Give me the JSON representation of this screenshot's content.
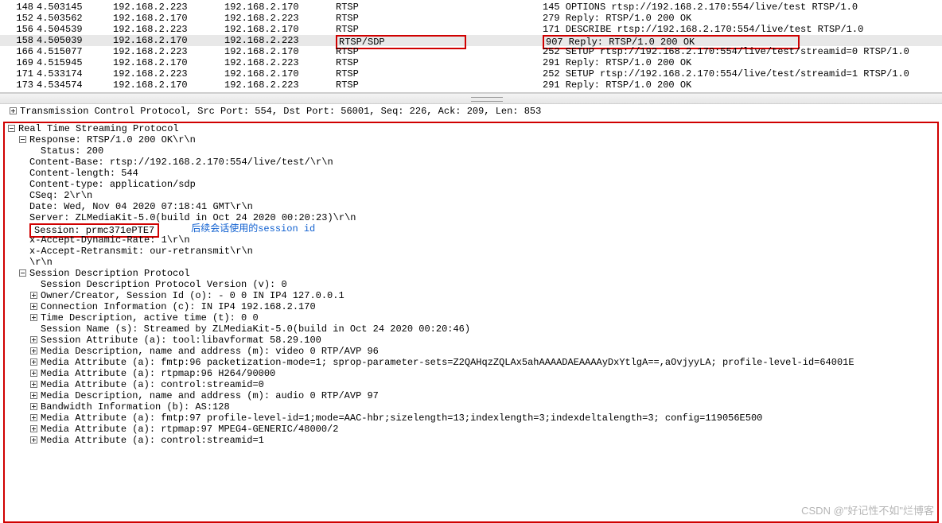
{
  "packets": [
    {
      "no": "148",
      "time": "4.503145",
      "src": "192.168.2.223",
      "dst": "192.168.2.170",
      "proto": "RTSP",
      "info": "145 OPTIONS rtsp://192.168.2.170:554/live/test RTSP/1.0",
      "sel": false,
      "hl": false
    },
    {
      "no": "152",
      "time": "4.503562",
      "src": "192.168.2.170",
      "dst": "192.168.2.223",
      "proto": "RTSP",
      "info": "279 Reply: RTSP/1.0 200 OK",
      "sel": false,
      "hl": false
    },
    {
      "no": "156",
      "time": "4.504539",
      "src": "192.168.2.223",
      "dst": "192.168.2.170",
      "proto": "RTSP",
      "info": "171 DESCRIBE rtsp://192.168.2.170:554/live/test RTSP/1.0",
      "sel": false,
      "hl": false
    },
    {
      "no": "158",
      "time": "4.505039",
      "src": "192.168.2.170",
      "dst": "192.168.2.223",
      "proto": "RTSP/SDP",
      "info": "907 Reply: RTSP/1.0 200 OK",
      "sel": true,
      "hl": true
    },
    {
      "no": "166",
      "time": "4.515077",
      "src": "192.168.2.223",
      "dst": "192.168.2.170",
      "proto": "RTSP",
      "info": "252 SETUP rtsp://192.168.2.170:554/live/test/streamid=0 RTSP/1.0",
      "sel": false,
      "hl": false
    },
    {
      "no": "169",
      "time": "4.515945",
      "src": "192.168.2.170",
      "dst": "192.168.2.223",
      "proto": "RTSP",
      "info": "291 Reply: RTSP/1.0 200 OK",
      "sel": false,
      "hl": false
    },
    {
      "no": "171",
      "time": "4.533174",
      "src": "192.168.2.223",
      "dst": "192.168.2.170",
      "proto": "RTSP",
      "info": "252 SETUP rtsp://192.168.2.170:554/live/test/streamid=1 RTSP/1.0",
      "sel": false,
      "hl": false
    },
    {
      "no": "173",
      "time": "4.534574",
      "src": "192.168.2.170",
      "dst": "192.168.2.223",
      "proto": "RTSP",
      "info": "291 Reply: RTSP/1.0 200 OK",
      "sel": false,
      "hl": false
    }
  ],
  "tcp_header": "Transmission Control Protocol, Src Port: 554, Dst Port: 56001, Seq: 226, Ack: 209, Len: 853",
  "rtsp": {
    "title": "Real Time Streaming Protocol",
    "response": "Response: RTSP/1.0 200 OK\\r\\n",
    "status": "Status: 200",
    "lines": [
      "Content-Base: rtsp://192.168.2.170:554/live/test/\\r\\n",
      "Content-length: 544",
      "Content-type: application/sdp",
      "CSeq: 2\\r\\n",
      "Date: Wed, Nov 04 2020 07:18:41 GMT\\r\\n",
      "Server: ZLMediaKit-5.0(build in Oct 24 2020 00:20:23)\\r\\n"
    ],
    "session": "Session: prmc371ePTE7",
    "annotation": "后续会话使用的session id",
    "lines2": [
      "x-Accept-Dynamic-Rate: 1\\r\\n",
      "x-Accept-Retransmit: our-retransmit\\r\\n",
      "\\r\\n"
    ]
  },
  "sdp": {
    "title": "Session Description Protocol",
    "items": [
      {
        "toggle": "",
        "text": "Session Description Protocol Version (v): 0"
      },
      {
        "toggle": "collapsed",
        "text": "Owner/Creator, Session Id (o): - 0 0 IN IP4 127.0.0.1"
      },
      {
        "toggle": "collapsed",
        "text": "Connection Information (c): IN IP4 192.168.2.170"
      },
      {
        "toggle": "collapsed",
        "text": "Time Description, active time (t): 0 0"
      },
      {
        "toggle": "",
        "text": "Session Name (s): Streamed by ZLMediaKit-5.0(build in Oct 24 2020 00:20:46)"
      },
      {
        "toggle": "collapsed",
        "text": "Session Attribute (a): tool:libavformat 58.29.100"
      },
      {
        "toggle": "collapsed",
        "text": "Media Description, name and address (m): video 0 RTP/AVP 96"
      },
      {
        "toggle": "collapsed",
        "text": "Media Attribute (a): fmtp:96 packetization-mode=1; sprop-parameter-sets=Z2QAHqzZQLAx5ahAAAADAEAAAAyDxYtlgA==,aOvjyyLA; profile-level-id=64001E"
      },
      {
        "toggle": "collapsed",
        "text": "Media Attribute (a): rtpmap:96 H264/90000"
      },
      {
        "toggle": "collapsed",
        "text": "Media Attribute (a): control:streamid=0"
      },
      {
        "toggle": "collapsed",
        "text": "Media Description, name and address (m): audio 0 RTP/AVP 97"
      },
      {
        "toggle": "collapsed",
        "text": "Bandwidth Information (b): AS:128"
      },
      {
        "toggle": "collapsed",
        "text": "Media Attribute (a): fmtp:97 profile-level-id=1;mode=AAC-hbr;sizelength=13;indexlength=3;indexdeltalength=3; config=119056E500"
      },
      {
        "toggle": "collapsed",
        "text": "Media Attribute (a): rtpmap:97 MPEG4-GENERIC/48000/2"
      },
      {
        "toggle": "collapsed",
        "text": "Media Attribute (a): control:streamid=1"
      }
    ]
  },
  "watermark": "CSDN @\"好记性不如\"烂博客"
}
